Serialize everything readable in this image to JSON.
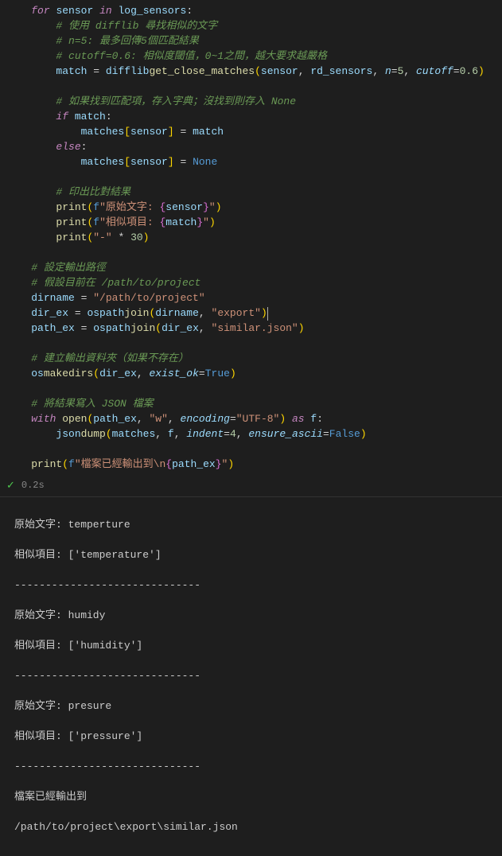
{
  "code": {
    "l1": {
      "for": "for",
      "sensor": "sensor",
      "in": "in",
      "log_sensors": "log_sensors",
      ":": ":"
    },
    "l2": "# 使用 difflib 尋找相似的文字",
    "l3": "# n=5: 最多回傳5個匹配結果",
    "l4": "# cutoff=0.6: 相似度閾值，0~1之間，越大要求越嚴格",
    "l5": {
      "match": "match",
      "eq": " = ",
      "difflib": "difflib",
      ".": ".",
      "gcm": "get_close_matches",
      "p1": "(",
      "sensor": "sensor",
      "c1": ", ",
      "rd": "rd_sensors",
      "c2": ", ",
      "n": "n",
      "eq2": "=",
      "n5": "5",
      "c3": ", ",
      "cutoff": "cutoff",
      "eq3": "=",
      "v6": "0.6",
      "p2": ")"
    },
    "l6": "# 如果找到匹配項，存入字典；沒找到則存入 None",
    "l7": {
      "if": "if",
      "match": "match",
      ":": ":"
    },
    "l8": {
      "matches": "matches",
      "b1": "[",
      "sensor": "sensor",
      "b2": "]",
      "eq": " = ",
      "match": "match"
    },
    "l9": {
      "else": "else",
      ":": ":"
    },
    "l10": {
      "matches": "matches",
      "b1": "[",
      "sensor": "sensor",
      "b2": "]",
      "eq": " = ",
      "none": "None"
    },
    "l11": "# 印出比對結果",
    "l12": {
      "print": "print",
      "p1": "(",
      "f": "f",
      "q1": "\"",
      "t1": "原始文字: ",
      "cb1": "{",
      "sensor": "sensor",
      "cb2": "}",
      "q2": "\"",
      "p2": ")"
    },
    "l13": {
      "print": "print",
      "p1": "(",
      "f": "f",
      "q1": "\"",
      "t1": "相似項目: ",
      "cb1": "{",
      "match": "match",
      "cb2": "}",
      "q2": "\"",
      "p2": ")"
    },
    "l14": {
      "print": "print",
      "p1": "(",
      "q1": "\"-\"",
      "m": " * ",
      "n30": "30",
      "p2": ")"
    },
    "l15": "# 設定輸出路徑",
    "l16": "# 假設目前在 /path/to/project",
    "l17": {
      "dirname": "dirname",
      "eq": " = ",
      "s": "\"/path/to/project\""
    },
    "l18": {
      "dir_ex": "dir_ex",
      "eq": " = ",
      "os": "os",
      ".": ".",
      "path": "path",
      ".2": ".",
      "join": "join",
      "p1": "(",
      "dirname": "dirname",
      "c": ", ",
      "s": "\"export\"",
      "p2": ")"
    },
    "l19": {
      "path_ex": "path_ex",
      "eq": " = ",
      "os": "os",
      ".": ".",
      "path": "path",
      ".2": ".",
      "join": "join",
      "p1": "(",
      "dir_ex": "dir_ex",
      "c": ", ",
      "s": "\"similar.json\"",
      "p2": ")"
    },
    "l20": "# 建立輸出資料夾（如果不存在）",
    "l21": {
      "os": "os",
      ".": ".",
      "makedirs": "makedirs",
      "p1": "(",
      "dir_ex": "dir_ex",
      "c": ", ",
      "exist_ok": "exist_ok",
      "eq": "=",
      "true": "True",
      "p2": ")"
    },
    "l22": "# 將結果寫入 JSON 檔案",
    "l23": {
      "with": "with",
      "open": "open",
      "p1": "(",
      "path_ex": "path_ex",
      "c1": ", ",
      "w": "\"w\"",
      "c2": ", ",
      "encoding": "encoding",
      "eq": "=",
      "utf": "\"UTF-8\"",
      "p2": ")",
      "as": "as",
      "f": "f",
      ":": ":"
    },
    "l24": {
      "json": "json",
      ".": ".",
      "dump": "dump",
      "p1": "(",
      "matches": "matches",
      "c1": ", ",
      "f": "f",
      "c2": ", ",
      "indent": "indent",
      "eq1": "=",
      "n4": "4",
      "c3": ", ",
      "ea": "ensure_ascii",
      "eq2": "=",
      "false": "False",
      "p2": ")"
    },
    "l25": {
      "print": "print",
      "p1": "(",
      "f": "f",
      "q1": "\"",
      "t1": "檔案已經輸出到\\n",
      "cb1": "{",
      "path_ex": "path_ex",
      "cb2": "}",
      "q2": "\"",
      "p2": ")"
    }
  },
  "status": {
    "time": "0.2s"
  },
  "output": {
    "o1": "原始文字: temperture",
    "o2": "相似項目: ['temperature']",
    "sep": "------------------------------",
    "o3": "原始文字: humidy",
    "o4": "相似項目: ['humidity']",
    "o5": "原始文字: presure",
    "o6": "相似項目: ['pressure']",
    "o7": "檔案已經輸出到",
    "o8": "/path/to/project\\export\\similar.json"
  }
}
